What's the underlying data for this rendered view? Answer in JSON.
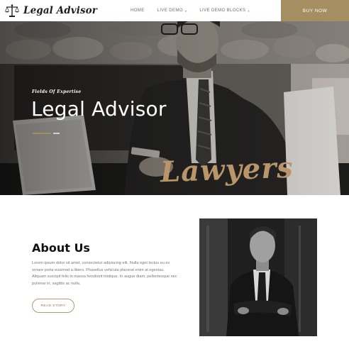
{
  "header": {
    "brand": "Legal Advisor",
    "logo_icon": "scales-of-justice-icon",
    "nav": [
      {
        "label": "HOME",
        "has_caret": false
      },
      {
        "label": "LIVE DEMO",
        "has_caret": true
      },
      {
        "label": "LIVE DEMO BLOCKS",
        "has_caret": true
      }
    ],
    "caret_glyph": "▾",
    "buy_label": "BUY NOW"
  },
  "hero": {
    "kicker": "Fields Of Expertise",
    "title": "Legal Advisor",
    "script_word": "Lawyers"
  },
  "about": {
    "title": "About Us",
    "body": "Lorem ipsum dolor sit amet, consectetur adipiscing elit. Nulla eget lectus eu ex ornare porta euismod a libero. Phasellus vehicula placerat enim at egestas. Aliquam suscipit felis in massa hendrerit tristique. In augue diam, pellentesque nec pulvinar in, sagittis ac nulla.",
    "button_label": "READ STORY"
  },
  "colors": {
    "accent": "#a68e63",
    "script": "#b8966a",
    "text_dark": "#111111"
  }
}
